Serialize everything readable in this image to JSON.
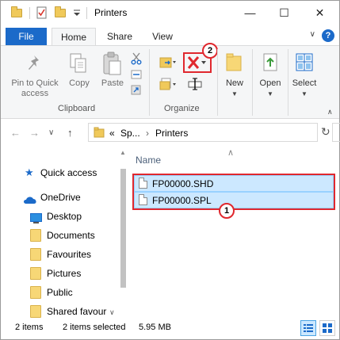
{
  "window": {
    "title": "Printers",
    "title_separator": "|",
    "minimize": "—",
    "maximize": "☐",
    "close": "✕"
  },
  "ribbon_tabs": {
    "file": "File",
    "home": "Home",
    "share": "Share",
    "view": "View",
    "help": "?"
  },
  "ribbon": {
    "pin_label_1": "Pin to Quick",
    "pin_label_2": "access",
    "copy": "Copy",
    "paste": "Paste",
    "clipboard_group": "Clipboard",
    "organize_group": "Organize",
    "new": "New",
    "open": "Open",
    "select": "Select"
  },
  "address": {
    "back": "←",
    "forward": "→",
    "recent": "∨",
    "up": "↑",
    "overflow": "«",
    "crumb_1": "Sp...",
    "crumb_sep": "›",
    "crumb_2": "Printers",
    "refresh": "↻"
  },
  "nav_pane": {
    "items": [
      {
        "label": "Quick access",
        "icon": "star-icon"
      },
      {
        "label": "OneDrive",
        "icon": "cloud-icon"
      },
      {
        "label": "Desktop",
        "icon": "desktop-icon"
      },
      {
        "label": "Documents",
        "icon": "folder-icon"
      },
      {
        "label": "Favourites",
        "icon": "folder-icon"
      },
      {
        "label": "Pictures",
        "icon": "folder-icon"
      },
      {
        "label": "Public",
        "icon": "folder-icon"
      },
      {
        "label": "Shared favour",
        "icon": "folder-icon"
      }
    ]
  },
  "file_list": {
    "column_name": "Name",
    "files": [
      {
        "name": "FP00000.SHD"
      },
      {
        "name": "FP00000.SPL"
      }
    ]
  },
  "annotations": {
    "badge_1": "1",
    "badge_2": "2",
    "accent_color": "#e0282e"
  },
  "status_bar": {
    "item_count": "2 items",
    "selection": "2 items selected",
    "size": "5.95 MB"
  },
  "colors": {
    "file_tab": "#1b6ac9",
    "selection": "#cce8ff",
    "delete_x": "#e0282e"
  }
}
